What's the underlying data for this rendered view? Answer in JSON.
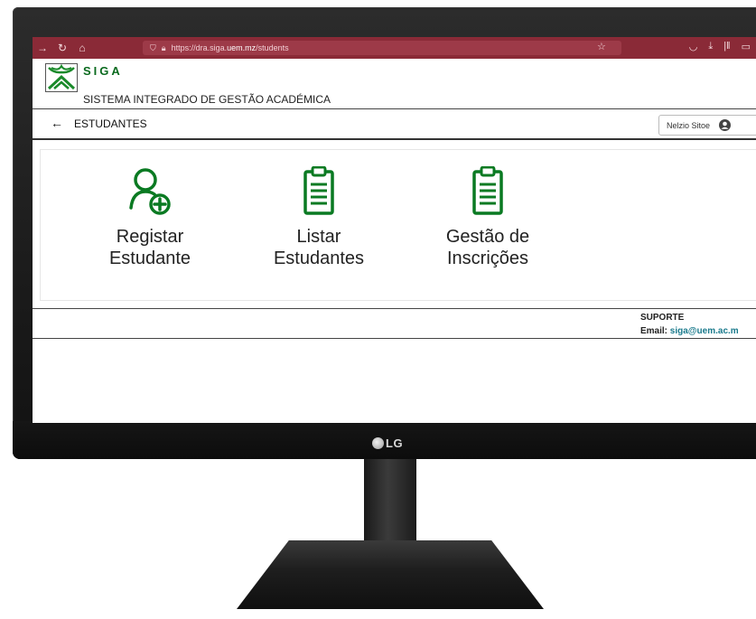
{
  "browser": {
    "url_prefix": "https://dra.siga.",
    "url_domain": "uem.mz",
    "url_path": "/students"
  },
  "header": {
    "app_name": "SIGA",
    "app_full_name": "SISTEMA INTEGRADO DE GESTÃO ACADÉMICA"
  },
  "page": {
    "title": "ESTUDANTES",
    "user_name": "Nelzio Sitoe"
  },
  "tiles": [
    {
      "label": "Registar\nEstudante",
      "icon": "user-add-icon"
    },
    {
      "label": "Listar\nEstudantes",
      "icon": "clipboard-list-icon"
    },
    {
      "label": "Gestão de\nInscrições",
      "icon": "clipboard-list-icon"
    }
  ],
  "footer": {
    "support_title": "SUPORTE",
    "email_label": "Email:",
    "email_value": "siga@uem.ac.m"
  },
  "monitor": {
    "brand": "LG"
  },
  "colors": {
    "browser_bar": "#8a2a37",
    "brand_green": "#0a7a22",
    "link_teal": "#1a7a8c"
  }
}
